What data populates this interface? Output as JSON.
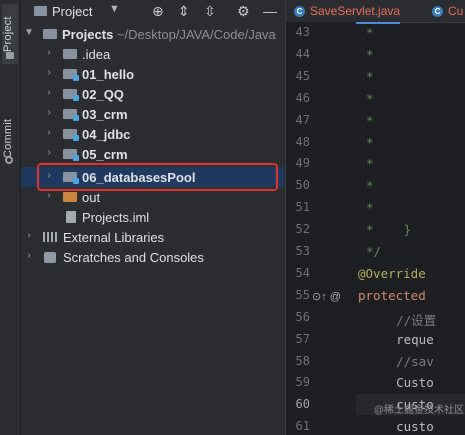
{
  "stripe": {
    "project_label": "Project",
    "commit_label": "Commit"
  },
  "toolbar": {
    "title": "Project"
  },
  "tree": {
    "root": {
      "name": "Projects",
      "path": "~/Desktop/JAVA/Code/Java"
    },
    "items": [
      {
        "label": ".idea"
      },
      {
        "label": "01_hello"
      },
      {
        "label": "02_QQ"
      },
      {
        "label": "03_crm"
      },
      {
        "label": "04_jdbc"
      },
      {
        "label": "05_crm"
      },
      {
        "label": "06_databasesPool"
      },
      {
        "label": "out"
      },
      {
        "label": "Projects.iml"
      },
      {
        "label": "External Libraries"
      },
      {
        "label": "Scratches and Consoles"
      }
    ]
  },
  "editor": {
    "tabs": [
      {
        "label": "SaveServlet.java",
        "badge": "C"
      },
      {
        "label": "Cu",
        "badge": "C"
      }
    ],
    "line_numbers": [
      "43",
      "44",
      "45",
      "46",
      "47",
      "48",
      "49",
      "50",
      "51",
      "52",
      "53",
      "54",
      "55",
      "56",
      "57",
      "58",
      "59",
      "60",
      "61"
    ],
    "lines": [
      "*",
      "*",
      "*",
      "*",
      "*",
      "*",
      "*",
      "*",
      "*",
      "*    }",
      "*/",
      "@Override",
      "protected",
      "    //设置",
      "    reque",
      "    //sav",
      "    Custo",
      "    custo",
      "    custo"
    ],
    "gutter_marks": "⊙↑ @"
  },
  "watermark": "@稀土掘金技术社区"
}
